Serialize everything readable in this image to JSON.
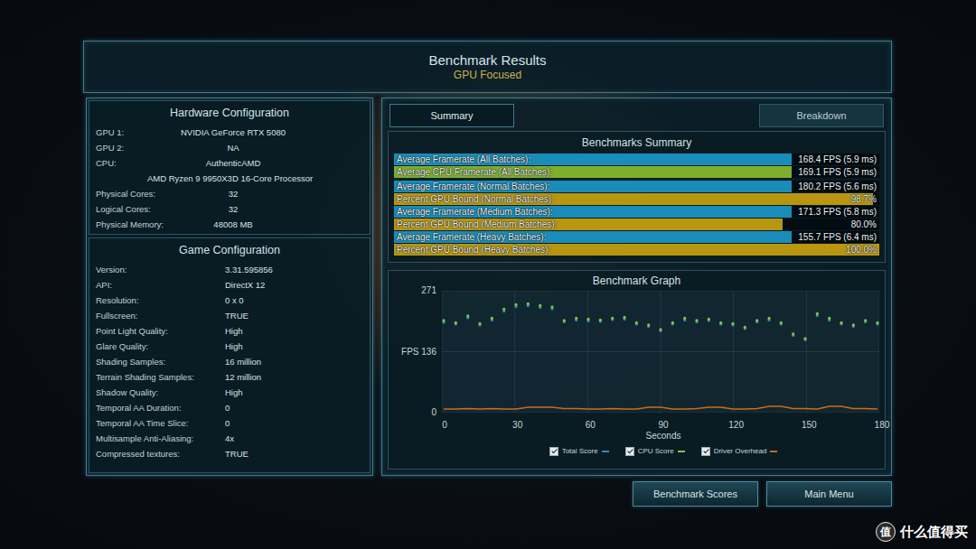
{
  "header": {
    "title": "Benchmark Results",
    "subtitle": "GPU Focused"
  },
  "hardware": {
    "title": "Hardware Configuration",
    "rows": [
      {
        "label": "GPU 1:",
        "value": "NVIDIA GeForce RTX 5080"
      },
      {
        "label": "GPU 2:",
        "value": "NA"
      },
      {
        "label": "CPU:",
        "value": "AuthenticAMD",
        "detail": "AMD Ryzen 9 9950X3D 16-Core Processor"
      },
      {
        "label": "Physical Cores:",
        "value": "32"
      },
      {
        "label": "Logical Cores:",
        "value": "32"
      },
      {
        "label": "Physical Memory:",
        "value": "48008 MB"
      }
    ]
  },
  "game": {
    "title": "Game Configuration",
    "rows": [
      {
        "label": "Version:",
        "value": "3.31.595856"
      },
      {
        "label": "API:",
        "value": "DirectX 12"
      },
      {
        "label": "Resolution:",
        "value": "0 x 0"
      },
      {
        "label": "Fullscreen:",
        "value": "TRUE"
      },
      {
        "label": "Point Light Quality:",
        "value": "High"
      },
      {
        "label": "Glare Quality:",
        "value": "High"
      },
      {
        "label": "Shading Samples:",
        "value": "16 million"
      },
      {
        "label": "Terrain Shading Samples:",
        "value": "12 million"
      },
      {
        "label": "Shadow Quality:",
        "value": "High"
      },
      {
        "label": "Temporal AA Duration:",
        "value": "0"
      },
      {
        "label": "Temporal AA Time Slice:",
        "value": "0"
      },
      {
        "label": "Multisample Anti-Aliasing:",
        "value": "4x"
      },
      {
        "label": "Compressed textures:",
        "value": "TRUE"
      }
    ]
  },
  "tabs": [
    {
      "label": "Summary",
      "selected": true
    },
    {
      "label": "Breakdown",
      "selected": false
    }
  ],
  "summary": {
    "title": "Benchmarks Summary",
    "bars": [
      {
        "label": "Average Framerate (All Batches):",
        "value": "168.4 FPS (5.9 ms)",
        "level": 0.82,
        "color": "#1a8cba"
      },
      {
        "label": "Average CPU Framerate (All Batches):",
        "value": "169.1 FPS (5.9 ms)",
        "level": 0.82,
        "color": "#7fae2c"
      },
      {
        "label": "Average Framerate (Normal Batches):",
        "value": "180.2 FPS (5.6 ms)",
        "level": 0.82,
        "color": "#1a8cba"
      },
      {
        "label": "Percent GPU Bound (Normal Batches):",
        "value": "98.7%",
        "level": 0.987,
        "color": "#b8960f"
      },
      {
        "label": "Average Framerate (Medium Batches):",
        "value": "171.3 FPS (5.8 ms)",
        "level": 0.82,
        "color": "#1a8cba"
      },
      {
        "label": "Percent GPU Bound (Medium Batches):",
        "value": "80.0%",
        "level": 0.8,
        "color": "#b8960f"
      },
      {
        "label": "Average Framerate (Heavy Batches):",
        "value": "155.7 FPS (6.4 ms)",
        "level": 0.82,
        "color": "#1a8cba"
      },
      {
        "label": "Percent GPU Bound (Heavy Batches):",
        "value": "100.0%",
        "level": 1.0,
        "color": "#b8960f"
      }
    ]
  },
  "graph": {
    "title": "Benchmark Graph",
    "y_ticks": [
      "271",
      "FPS 136",
      "0"
    ],
    "x_ticks": [
      "0",
      "30",
      "60",
      "90",
      "120",
      "150",
      "180"
    ],
    "x_label": "Seconds",
    "series": [
      {
        "label": "Total Score",
        "checked": true,
        "color": "#2a8fc0",
        "kind": "points",
        "values": [
          201,
          197,
          211,
          195,
          206,
          226,
          236,
          238,
          234,
          231,
          202,
          206,
          204,
          203,
          207,
          208,
          197,
          192,
          182,
          197,
          206,
          202,
          205,
          197,
          195,
          187,
          202,
          206,
          197,
          172,
          162,
          216,
          206,
          197,
          192,
          202,
          197
        ]
      },
      {
        "label": "CPU Score",
        "checked": true,
        "color": "#8cc43a",
        "kind": "points",
        "values": [
          205,
          200,
          215,
          198,
          210,
          230,
          240,
          242,
          238,
          235,
          205,
          210,
          208,
          206,
          210,
          212,
          200,
          195,
          185,
          200,
          210,
          205,
          208,
          200,
          198,
          190,
          205,
          210,
          200,
          175,
          165,
          220,
          210,
          200,
          195,
          205,
          200
        ]
      },
      {
        "label": "Driver Overhead",
        "checked": true,
        "color": "#d06a1c",
        "kind": "line",
        "values": [
          8,
          8,
          9,
          8,
          9,
          8,
          8,
          12,
          12,
          12,
          9,
          9,
          8,
          8,
          9,
          8,
          8,
          12,
          12,
          8,
          8,
          9,
          12,
          12,
          8,
          8,
          9,
          14,
          14,
          9,
          9,
          8,
          14,
          14,
          9,
          9,
          8
        ]
      }
    ]
  },
  "buttons": [
    "Benchmark Scores",
    "Main Menu"
  ],
  "watermark": {
    "icon": "值",
    "text": "什么值得买"
  }
}
